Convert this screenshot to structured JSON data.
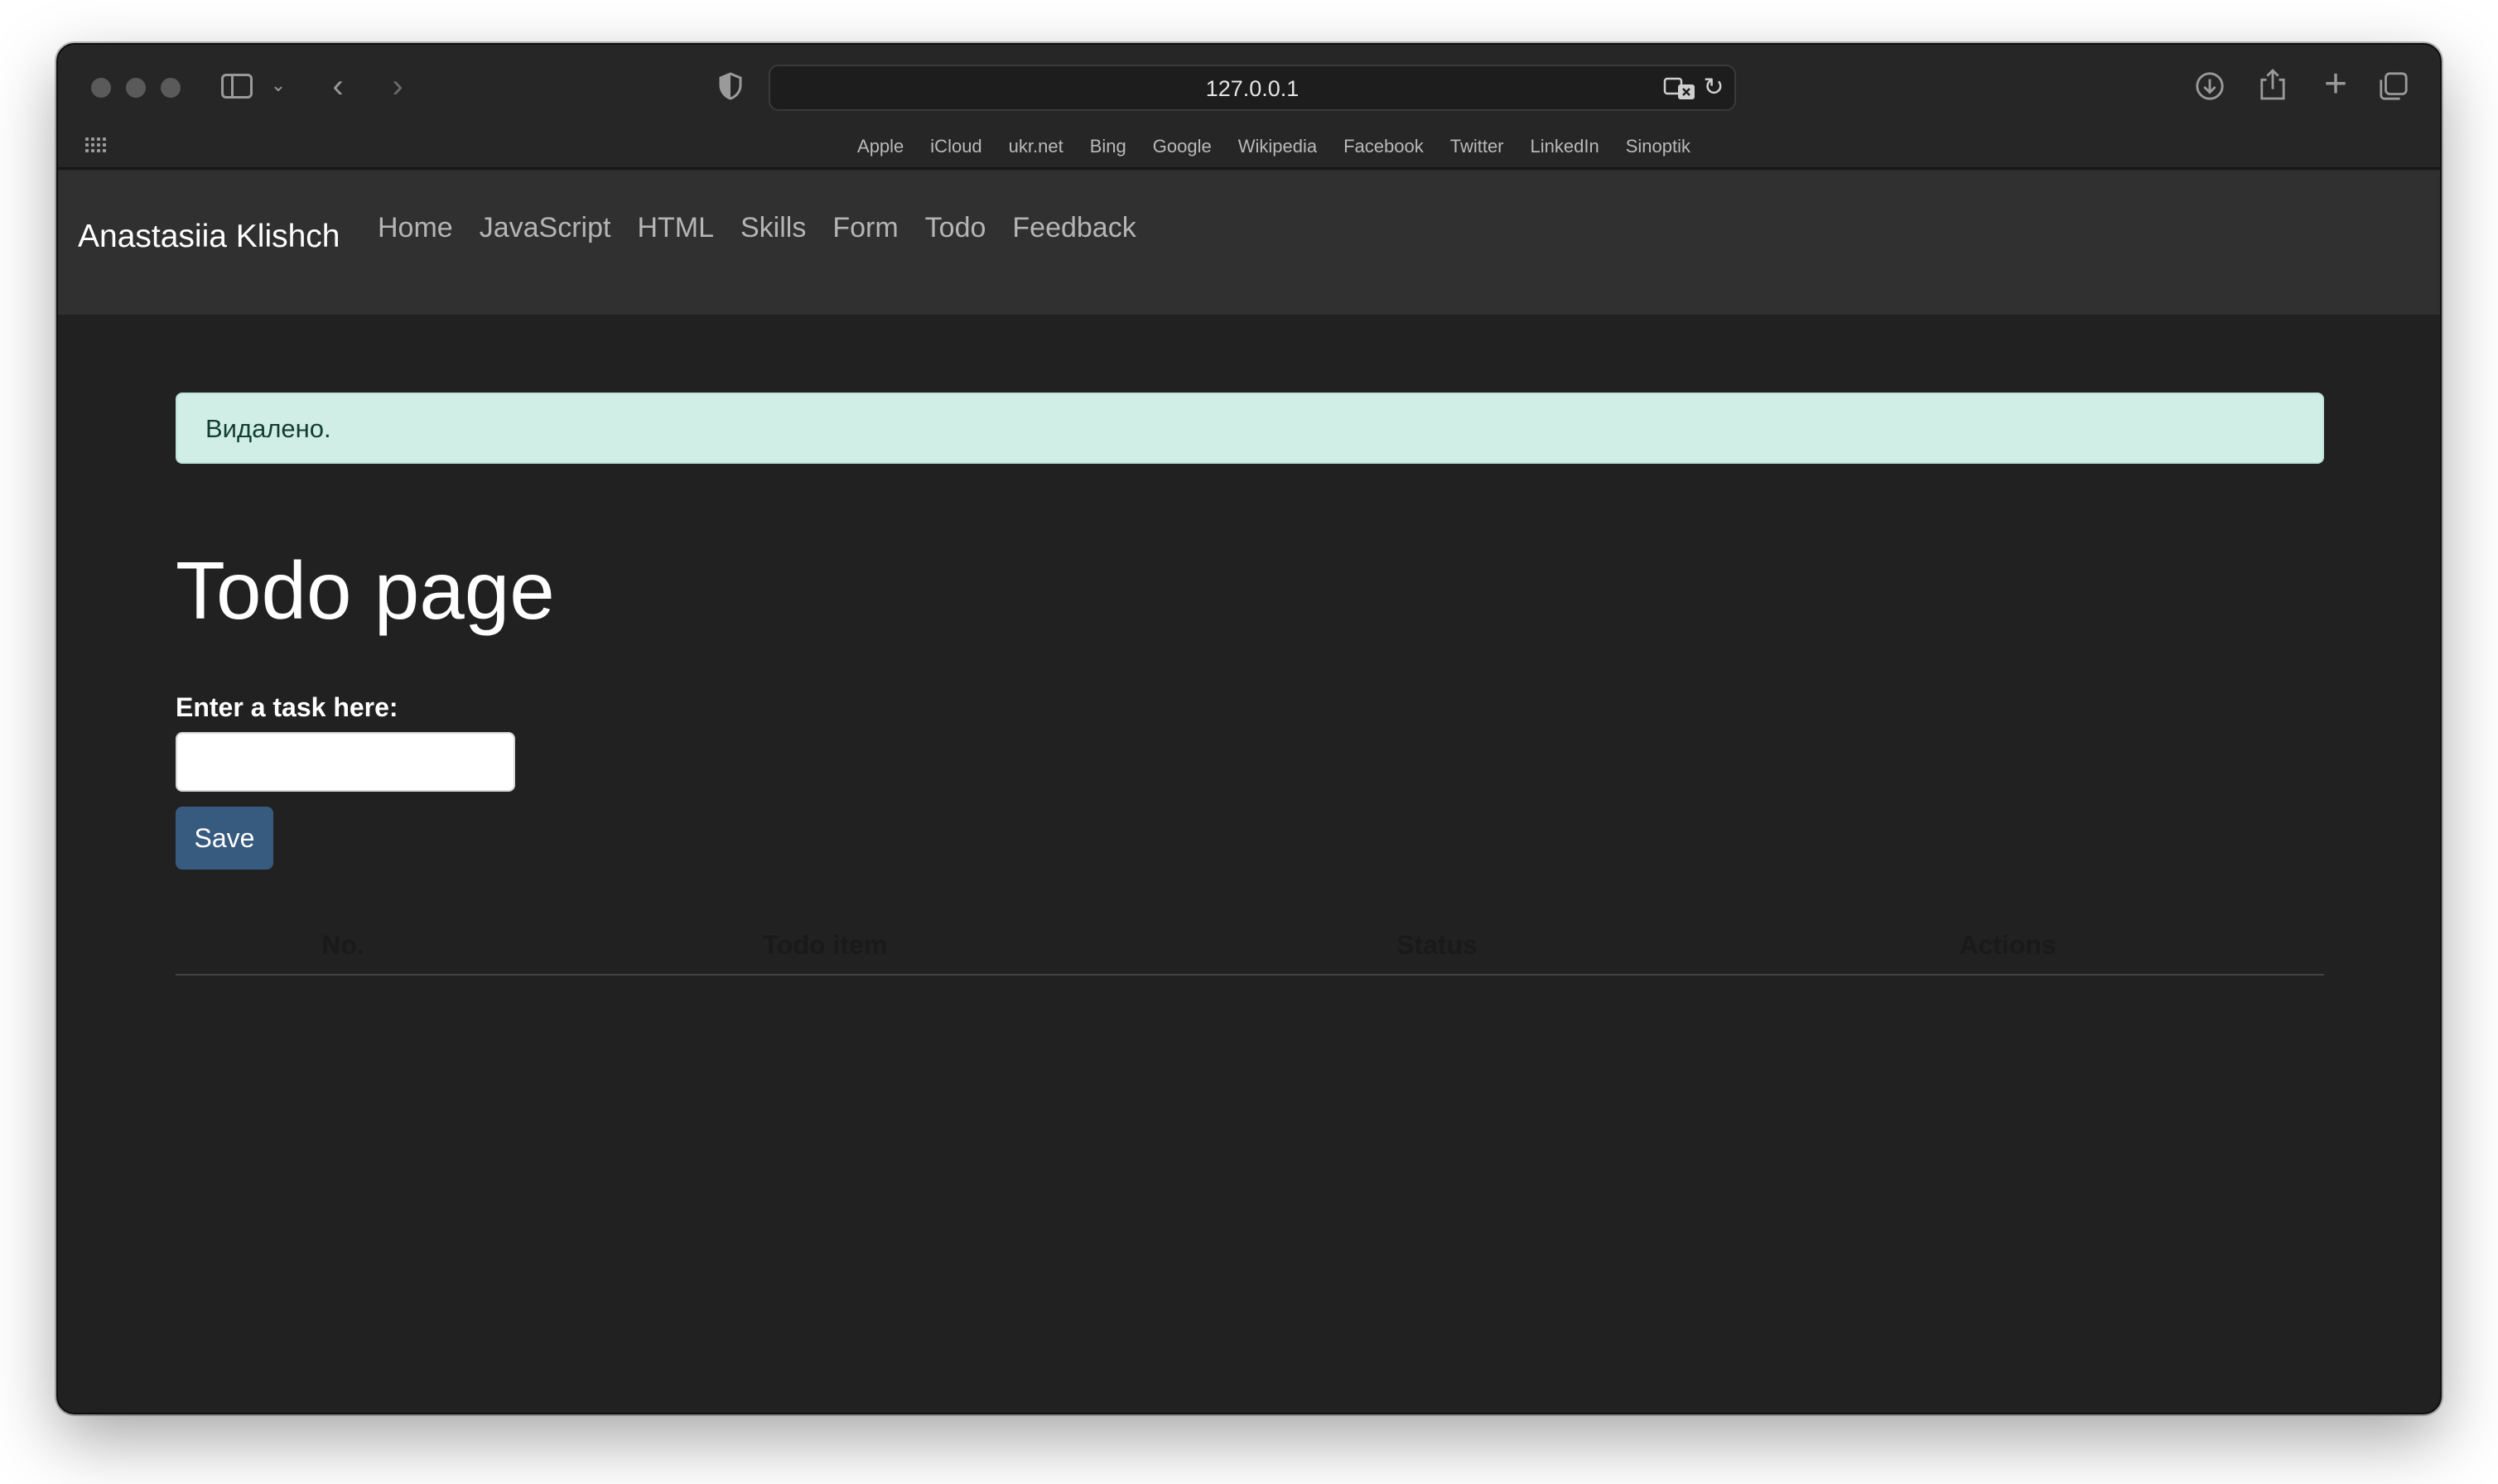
{
  "browser": {
    "url": "127.0.0.1",
    "favorites": [
      "Apple",
      "iCloud",
      "ukr.net",
      "Bing",
      "Google",
      "Wikipedia",
      "Facebook",
      "Twitter",
      "LinkedIn",
      "Sinoptik"
    ],
    "icons": {
      "sidebar": "sidebar-icon",
      "back": "chevron-left-icon",
      "forward": "chevron-right-icon",
      "privacy": "shield-icon",
      "translate": "translate-icon",
      "reload": "reload-icon",
      "downloads": "download-icon",
      "share": "share-icon",
      "new_tab": "plus-icon",
      "tab_overview": "tabs-icon",
      "apps": "grid-icon"
    }
  },
  "navbar": {
    "brand": "Anastasiia Klishch",
    "links": [
      "Home",
      "JavaScript",
      "HTML",
      "Skills",
      "Form",
      "Todo",
      "Feedback"
    ]
  },
  "alert": {
    "message": "Видалено."
  },
  "main": {
    "title": "Todo page",
    "task_label": "Enter a task here:",
    "task_input_value": "",
    "save_label": "Save"
  },
  "table": {
    "headers": [
      "No.",
      "Todo item",
      "Status",
      "Actions"
    ],
    "rows": []
  },
  "colors": {
    "page_bg": "#212121",
    "navbar_bg": "#303030",
    "alert_bg": "#d1eee6",
    "alert_text": "#123e30",
    "primary_button": "#375a7f"
  }
}
